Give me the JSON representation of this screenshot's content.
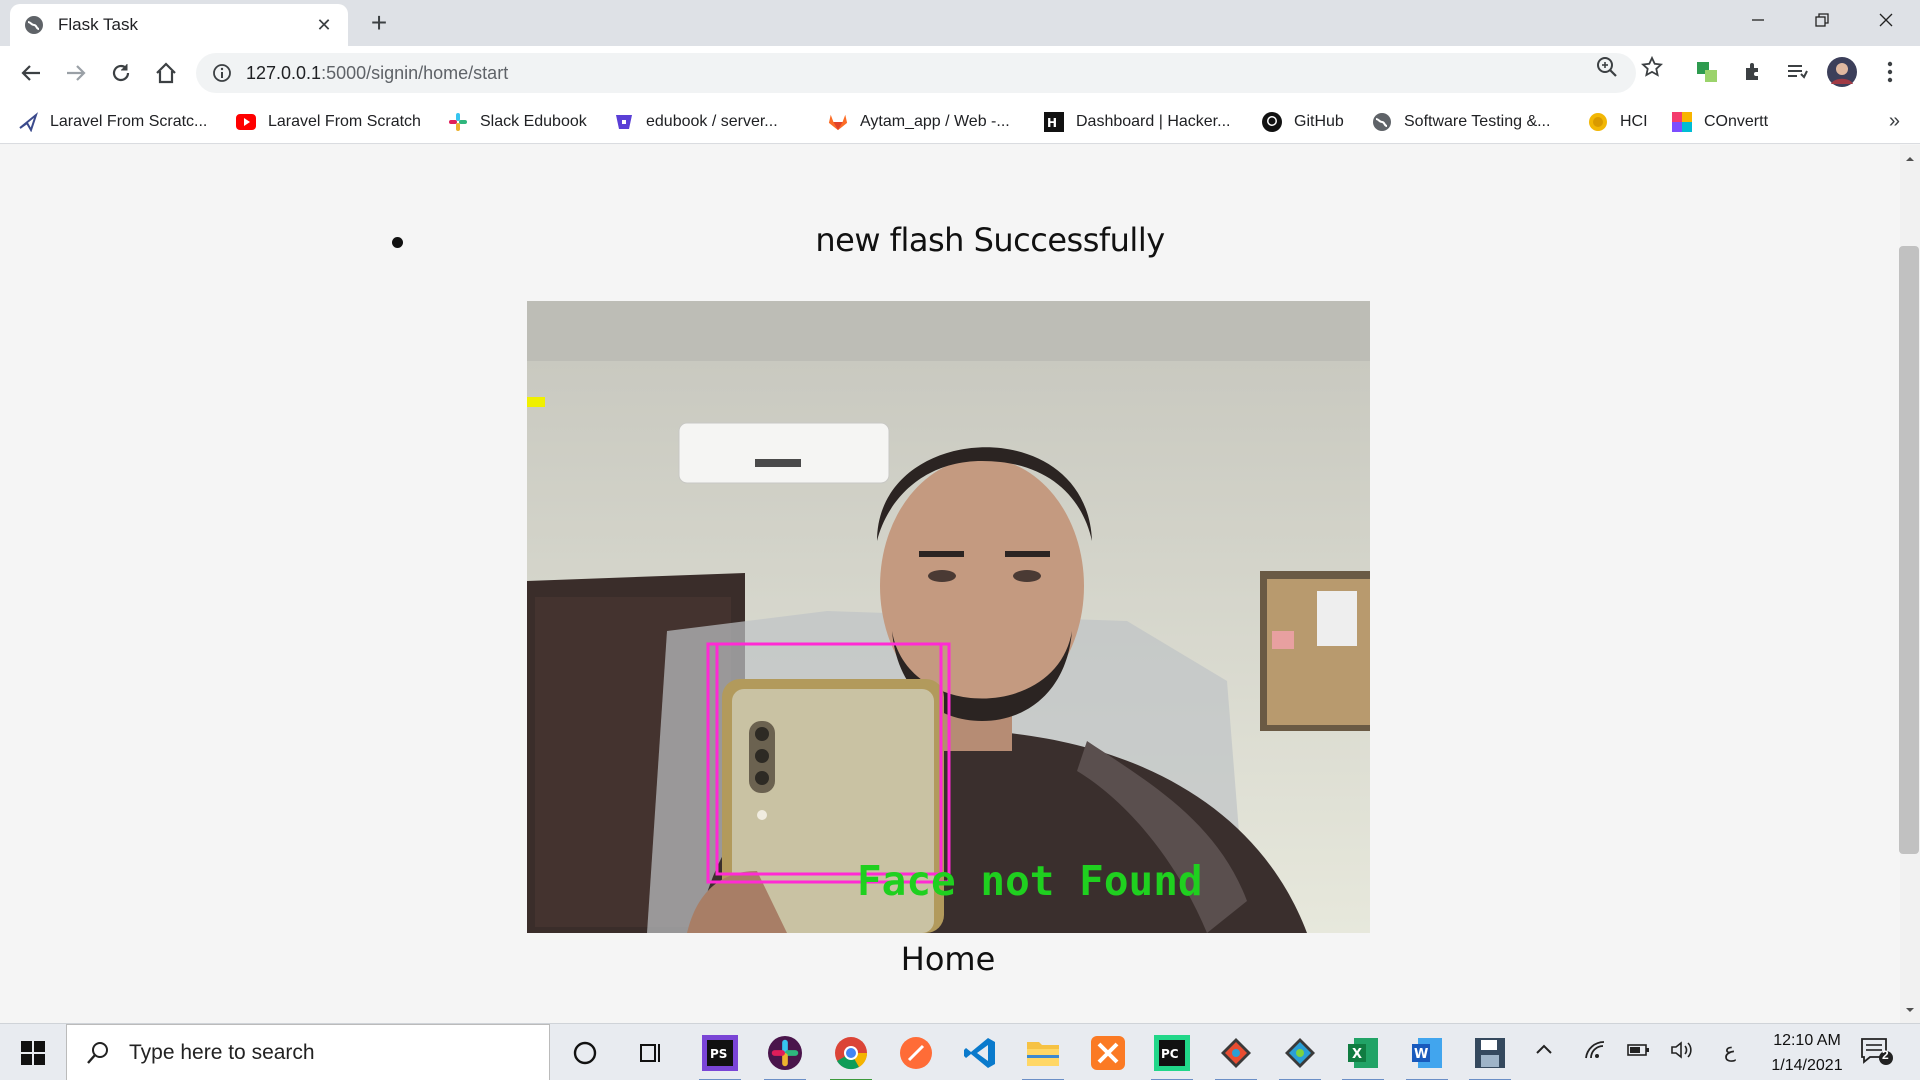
{
  "browser": {
    "tab_title": "Flask Task",
    "tab_close": "✕",
    "new_tab": "+",
    "url_host": "127.0.0.1",
    "url_path": ":5000/signin/home/start",
    "bookmarks": [
      {
        "label": "Laravel From Scratc...",
        "icon": "laravel-icon"
      },
      {
        "label": "Laravel From Scratch",
        "icon": "youtube-icon"
      },
      {
        "label": "Slack Edubook",
        "icon": "slack-icon"
      },
      {
        "label": "edubook / server...",
        "icon": "bitbucket-icon"
      },
      {
        "label": "Aytam_app / Web -...",
        "icon": "gitlab-icon"
      },
      {
        "label": "Dashboard | Hacker...",
        "icon": "hackerrank-icon"
      },
      {
        "label": "GitHub",
        "icon": "github-icon"
      },
      {
        "label": "Software Testing &...",
        "icon": "globe-icon"
      },
      {
        "label": "HCI",
        "icon": "coin-icon"
      },
      {
        "label": "COnvertt",
        "icon": "convert-icon"
      }
    ],
    "bookmarks_more": "»"
  },
  "page": {
    "flash_message": "new flash Successfully",
    "video_overlay_text": "Face not Found",
    "home_link": "Home"
  },
  "taskbar": {
    "search_placeholder": "Type here to search",
    "language": "ع",
    "time": "12:10 AM",
    "date": "1/14/2021",
    "notifications": "2"
  },
  "colors": {
    "detection_box": "#ff2ad4",
    "overlay_text": "#1fd01f",
    "accent": "#1a73e8"
  }
}
